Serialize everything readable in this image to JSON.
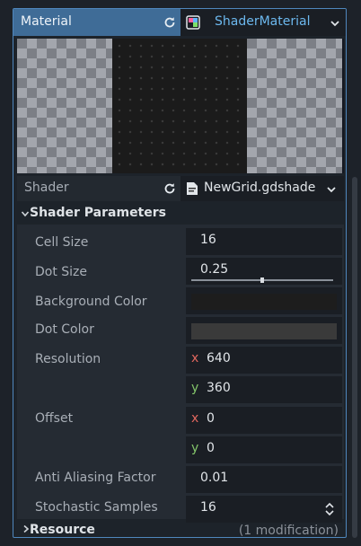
{
  "header": {
    "property_label": "Material",
    "resource_name": "ShaderMaterial"
  },
  "shader": {
    "label": "Shader",
    "file_name": "NewGrid.gdshade"
  },
  "section": {
    "title": "Shader Parameters"
  },
  "params": {
    "cell_size": {
      "label": "Cell Size",
      "value": "16"
    },
    "dot_size": {
      "label": "Dot Size",
      "value": "0.25",
      "slider_fraction": 0.5
    },
    "background_color": {
      "label": "Background Color",
      "color": "#1d1d1d"
    },
    "dot_color": {
      "label": "Dot Color",
      "color": "#3a3a3a"
    },
    "resolution": {
      "label": "Resolution",
      "x_axis": "x",
      "x_value": "640",
      "y_axis": "y",
      "y_value": "360"
    },
    "offset": {
      "label": "Offset",
      "x_axis": "x",
      "x_value": "0",
      "y_axis": "y",
      "y_value": "0"
    },
    "anti_aliasing": {
      "label": "Anti Aliasing Factor",
      "value": "0.01"
    },
    "stochastic_samples": {
      "label": "Stochastic Samples",
      "value": "16"
    }
  },
  "resource": {
    "title": "Resource",
    "modification_note": "(1 modification)"
  },
  "colors": {
    "accent": "#4f87bd",
    "header_bg": "#3f6c97",
    "resource_link": "#6cb8ee",
    "axis_x": "#e0675e",
    "axis_y": "#83c46a"
  },
  "icons": {
    "revert": "revert-icon",
    "shader_material": "shader-material-icon",
    "dropdown": "chevron-down-icon",
    "file": "shader-file-icon",
    "expanded": "caret-down-icon",
    "collapsed": "caret-right-icon",
    "spinner": "spinner-arrows-icon"
  }
}
